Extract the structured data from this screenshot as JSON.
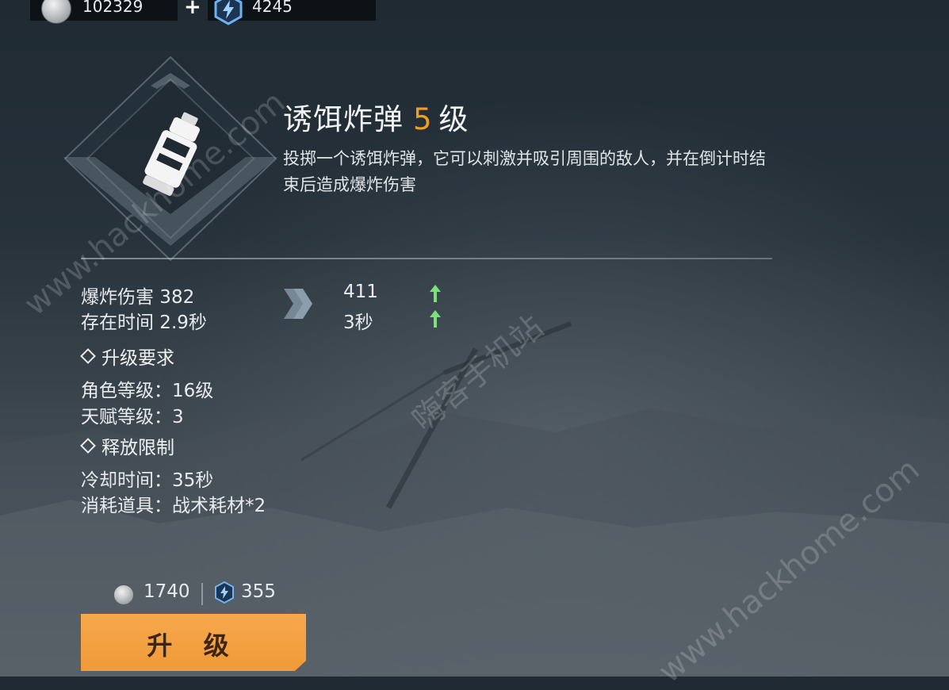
{
  "currency": {
    "coins": "102329",
    "plus": "+",
    "energy": "4245"
  },
  "skill": {
    "name": "诱饵炸弹",
    "level": "5",
    "level_suffix": "级",
    "description": "投掷一个诱饵炸弹，它可以刺激并吸引周围的敌人，并在倒计时结束后造成爆炸伤害"
  },
  "stats": [
    {
      "label": "爆炸伤害 382",
      "next": "411"
    },
    {
      "label": "存在时间 2.9秒",
      "next": "3秒"
    }
  ],
  "requirements": {
    "title": "升级要求",
    "items": [
      "角色等级：16级",
      "天赋等级：3"
    ]
  },
  "limits": {
    "title": "释放限制",
    "items": [
      "冷却时间：35秒",
      "消耗道具：战术耗材*2"
    ]
  },
  "cost": {
    "coins": "1740",
    "energy": "355"
  },
  "upgrade_button": "升 级",
  "watermarks": [
    "www.hackhome.com",
    "嗨客手机站",
    "www.hackhome.com"
  ],
  "colors": {
    "accent": "#f0a020",
    "button": "#f3a040",
    "up_arrow": "#7ee07a"
  }
}
